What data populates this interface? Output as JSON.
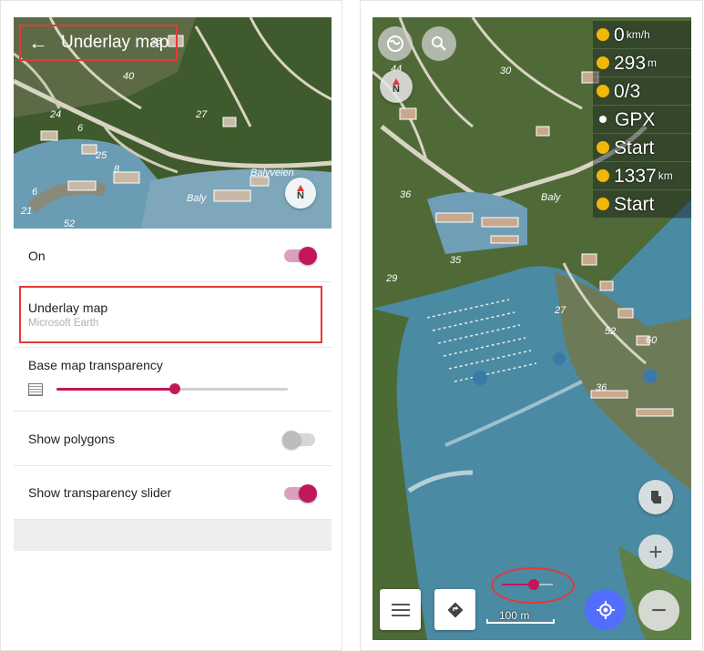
{
  "left": {
    "header": {
      "back_glyph": "←",
      "title": "Underlay map"
    },
    "compass_label": "N",
    "map_labels": [
      "40",
      "36",
      "24",
      "27",
      "6",
      "8",
      "6",
      "52",
      "25",
      "21",
      "Baly",
      "Balyveien"
    ],
    "settings": {
      "on": {
        "label": "On",
        "toggle": "on"
      },
      "underlay": {
        "label": "Underlay map",
        "value": "Microsoft Earth"
      },
      "transparency": {
        "label": "Base map transparency",
        "slider_fraction": 0.51
      },
      "polygons": {
        "label": "Show polygons",
        "toggle": "off"
      },
      "transparency_slider": {
        "label": "Show transparency slider",
        "toggle": "on"
      }
    }
  },
  "right": {
    "compass_label": "N",
    "map_labels": [
      "44",
      "30",
      "36",
      "35",
      "29",
      "27",
      "52",
      "60",
      "36",
      "Baly"
    ],
    "info_panel": [
      {
        "icon": "speedometer-icon",
        "value": "0",
        "unit": "km/h"
      },
      {
        "icon": "altitude-icon",
        "value": "293",
        "unit": "m"
      },
      {
        "icon": "satellite-icon",
        "value": "0/3",
        "unit": ""
      },
      {
        "icon": "gpx-dot-icon",
        "value": "GPX",
        "unit": ""
      },
      {
        "icon": "camera-icon",
        "value": "Start",
        "unit": ""
      },
      {
        "icon": "eye-icon",
        "value": "1337",
        "unit": "km"
      },
      {
        "icon": "face-icon",
        "value": "Start",
        "unit": ""
      }
    ],
    "transparency_slider_fraction": 0.62,
    "scale_label": "100 m",
    "zoom_in_glyph": "+",
    "zoom_out_glyph": "−"
  },
  "colors": {
    "accent": "#c2185b",
    "highlight": "#e53935",
    "gps_button": "#536dfe"
  }
}
